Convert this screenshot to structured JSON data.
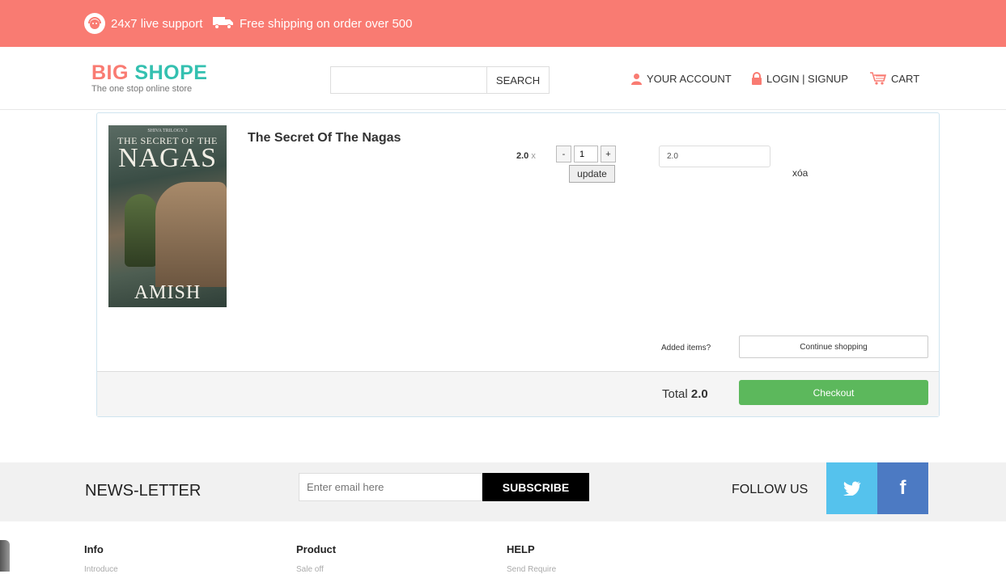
{
  "topbar": {
    "support_text": "24x7 live support",
    "shipping_text": "Free shipping on order over 500",
    "background": "#f97b72"
  },
  "header": {
    "logo_part1": "BIG",
    "logo_part2": "SHOPE",
    "tagline": "The one stop online store",
    "search_placeholder": "",
    "search_button": "SEARCH",
    "account_label": "YOUR ACCOUNT",
    "login_label": "LOGIN | SIGNUP",
    "cart_label": "CART",
    "accent_color": "#f97b72",
    "secondary_color": "#34c0b0"
  },
  "cart": {
    "item": {
      "name": "The Secret Of The Nagas",
      "cover": {
        "series": "SHIVA TRILOGY 2",
        "title_line1": "THE SECRET OF THE",
        "title_line2": "NAGAS",
        "author": "AMISH"
      },
      "unit_price": "2.0",
      "times_sign": "x",
      "decrement": "-",
      "quantity": "1",
      "increment": "+",
      "update_label": "update",
      "line_total": "2.0",
      "remove_label": "xóa"
    },
    "added_items_label": "Added items?",
    "continue_label": "Continue shopping",
    "total_label": "Total",
    "total_value": "2.0",
    "checkout_label": "Checkout",
    "checkout_color": "#5cb85c"
  },
  "newsletter": {
    "title": "NEWS-LETTER",
    "email_placeholder": "Enter email here",
    "subscribe_label": "SUBSCRIBE",
    "follow_label": "FOLLOW US",
    "twitter_color": "#55c2ed",
    "facebook_color": "#4c7ac3",
    "facebook_glyph": "f"
  },
  "footer": {
    "columns": [
      {
        "heading": "Info",
        "first_link": "Introduce"
      },
      {
        "heading": "Product",
        "first_link": "Sale off"
      },
      {
        "heading": "HELP",
        "first_link": "Send Require"
      }
    ]
  }
}
